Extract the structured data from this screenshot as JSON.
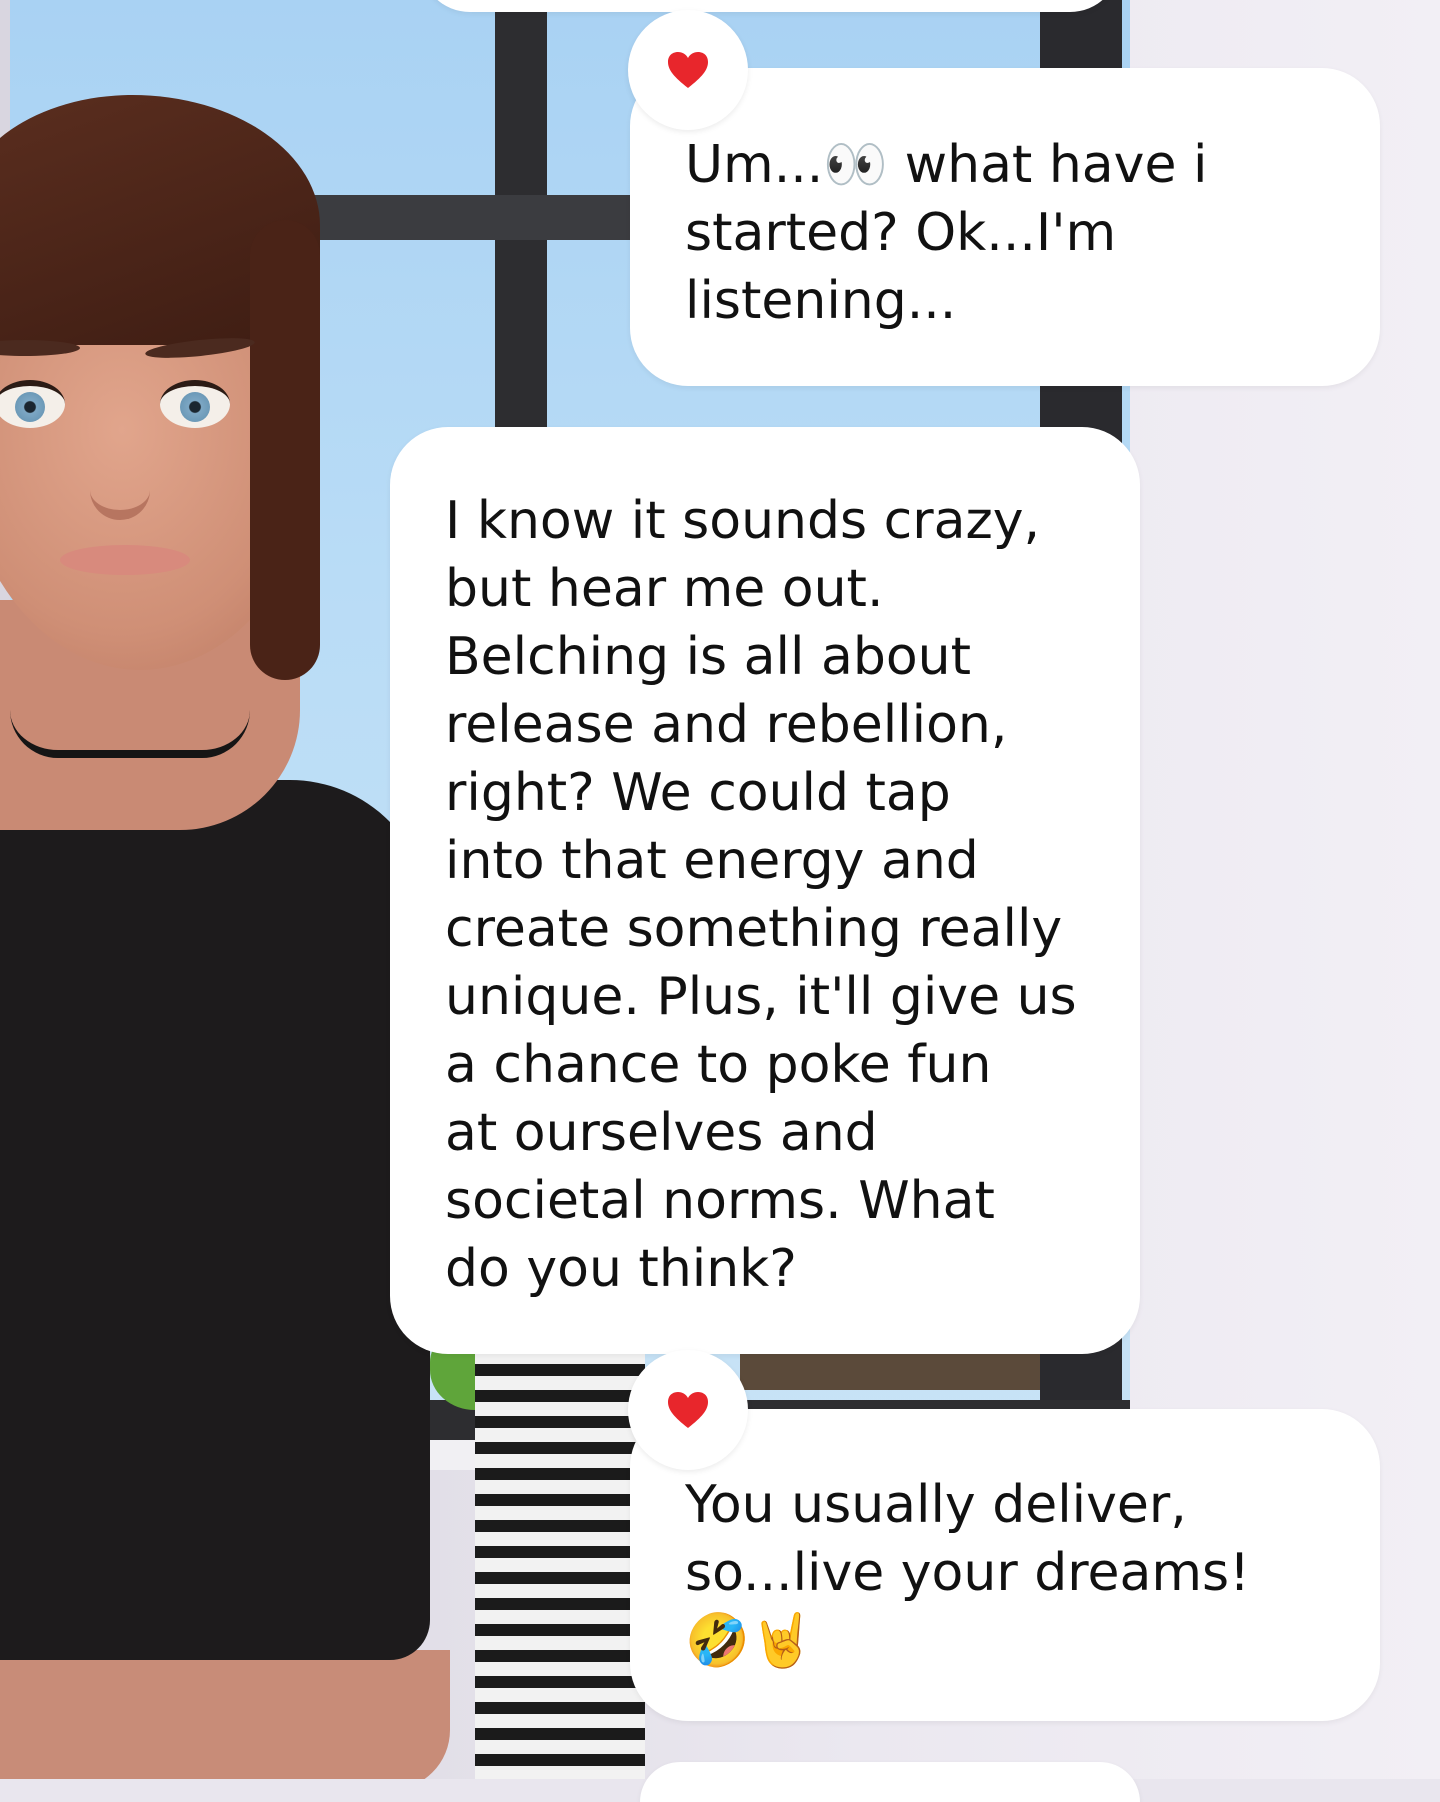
{
  "messages": [
    {
      "sender": "user",
      "text": "Um...👀 what have i\nstarted? Ok...I'm\nlistening...",
      "reaction": "heart-icon"
    },
    {
      "sender": "character",
      "text": "I know it sounds crazy,\nbut hear me out.\nBelching is all about\nrelease and rebellion,\nright? We could tap\ninto that energy and\ncreate something really\nunique. Plus, it'll give us\na chance to poke fun\nat ourselves and\nsocietal norms. What\ndo you think?"
    },
    {
      "sender": "user",
      "text": "You usually deliver,\nso...live your dreams!\n🤣🤘",
      "reaction": "heart-icon"
    }
  ],
  "colors": {
    "bubble": "#ffffff",
    "text": "#111111",
    "heart": "#e8262c"
  }
}
